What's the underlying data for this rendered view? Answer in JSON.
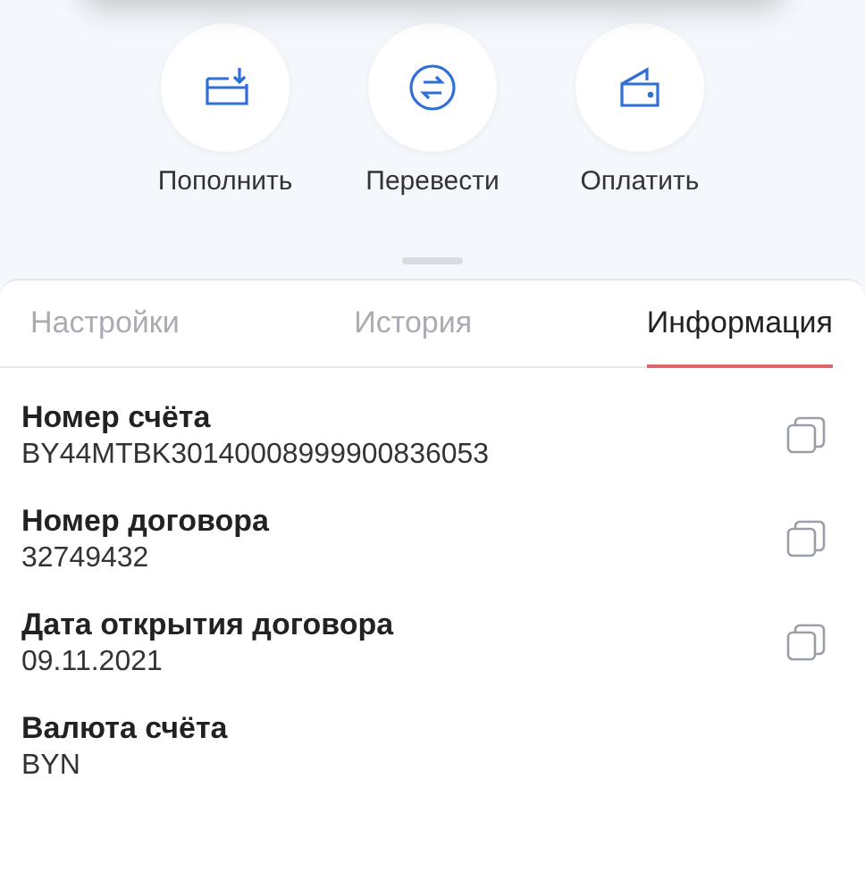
{
  "actions": [
    {
      "kind": "topup",
      "label": "Пополнить"
    },
    {
      "kind": "transfer",
      "label": "Перевести"
    },
    {
      "kind": "pay",
      "label": "Оплатить"
    }
  ],
  "tabs": [
    {
      "label": "Настройки",
      "selected": false
    },
    {
      "label": "История",
      "selected": false
    },
    {
      "label": "Информация",
      "selected": true
    }
  ],
  "fields": [
    {
      "label": "Номер счёта",
      "value": "BY44MTBK30140008999900836053",
      "copyable": true
    },
    {
      "label": "Номер договора",
      "value": "32749432",
      "copyable": true
    },
    {
      "label": "Дата открытия договора",
      "value": "09.11.2021",
      "copyable": true
    },
    {
      "label": "Валюта счёта",
      "value": "BYN",
      "copyable": false
    }
  ]
}
